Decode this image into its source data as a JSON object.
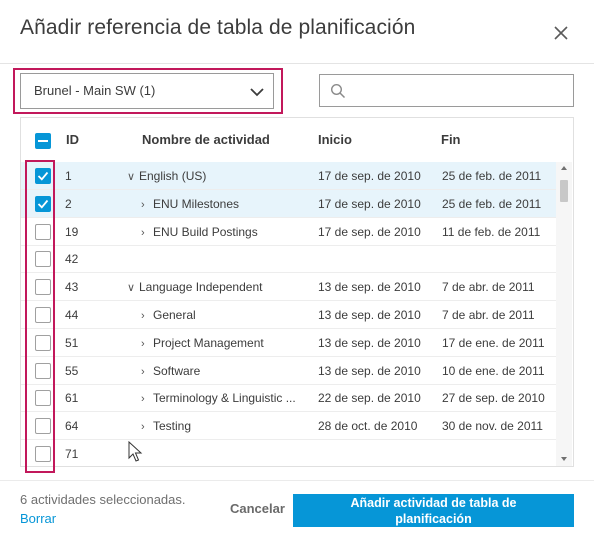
{
  "dialog": {
    "title": "Añadir referencia de tabla de planificación",
    "close_icon": "close-icon"
  },
  "schedule_select": {
    "value": "Brunel - Main SW (1)",
    "icon": "chevron-down-icon"
  },
  "search": {
    "placeholder": "",
    "icon": "search-icon"
  },
  "table": {
    "columns": {
      "id": "ID",
      "name": "Nombre de actividad",
      "start": "Inicio",
      "end": "Fin"
    },
    "select_all_state": "indeterminate",
    "rows": [
      {
        "checked": true,
        "id": "1",
        "expander": "⌄",
        "name": "English (US)",
        "start": "17 de sep. de 2010",
        "end": "25 de feb. de 2011"
      },
      {
        "checked": true,
        "id": "2",
        "expander": "›",
        "name": "ENU Milestones",
        "start": "17 de sep. de 2010",
        "end": "25 de feb. de 2011"
      },
      {
        "checked": false,
        "id": "19",
        "expander": "›",
        "name": "ENU Build Postings",
        "start": "17 de sep. de 2010",
        "end": "11 de feb. de 2011"
      },
      {
        "checked": false,
        "id": "42",
        "expander": "",
        "name": "",
        "start": "",
        "end": ""
      },
      {
        "checked": false,
        "id": "43",
        "expander": "⌄",
        "name": "Language Independent",
        "start": "13 de sep. de 2010",
        "end": "7 de abr. de 2011"
      },
      {
        "checked": false,
        "id": "44",
        "expander": "›",
        "name": "General",
        "start": "13 de sep. de 2010",
        "end": "7 de abr. de 2011"
      },
      {
        "checked": false,
        "id": "51",
        "expander": "›",
        "name": "Project Management",
        "start": "13 de sep. de 2010",
        "end": "17 de ene. de 2011"
      },
      {
        "checked": false,
        "id": "55",
        "expander": "›",
        "name": "Software",
        "start": "13 de sep. de 2010",
        "end": "10 de ene. de 2011"
      },
      {
        "checked": false,
        "id": "61",
        "expander": "›",
        "name": "Terminology & Linguistic ...",
        "start": "22 de sep. de 2010",
        "end": "27 de sep. de 2010"
      },
      {
        "checked": false,
        "id": "64",
        "expander": "›",
        "name": "Testing",
        "start": "28 de oct. de 2010",
        "end": "30 de nov. de 2011"
      },
      {
        "checked": false,
        "id": "71",
        "expander": "",
        "name": "",
        "start": "",
        "end": ""
      }
    ]
  },
  "footer": {
    "selected_count": "6 actividades seleccionadas.",
    "clear_label": "Borrar",
    "cancel_label": "Cancelar",
    "add_label_line1": "Añadir actividad de tabla de",
    "add_label_line2": "planificación"
  },
  "colors": {
    "accent": "#0696d7",
    "highlight": "#c2185b",
    "row_selected": "#e7f4fb"
  }
}
